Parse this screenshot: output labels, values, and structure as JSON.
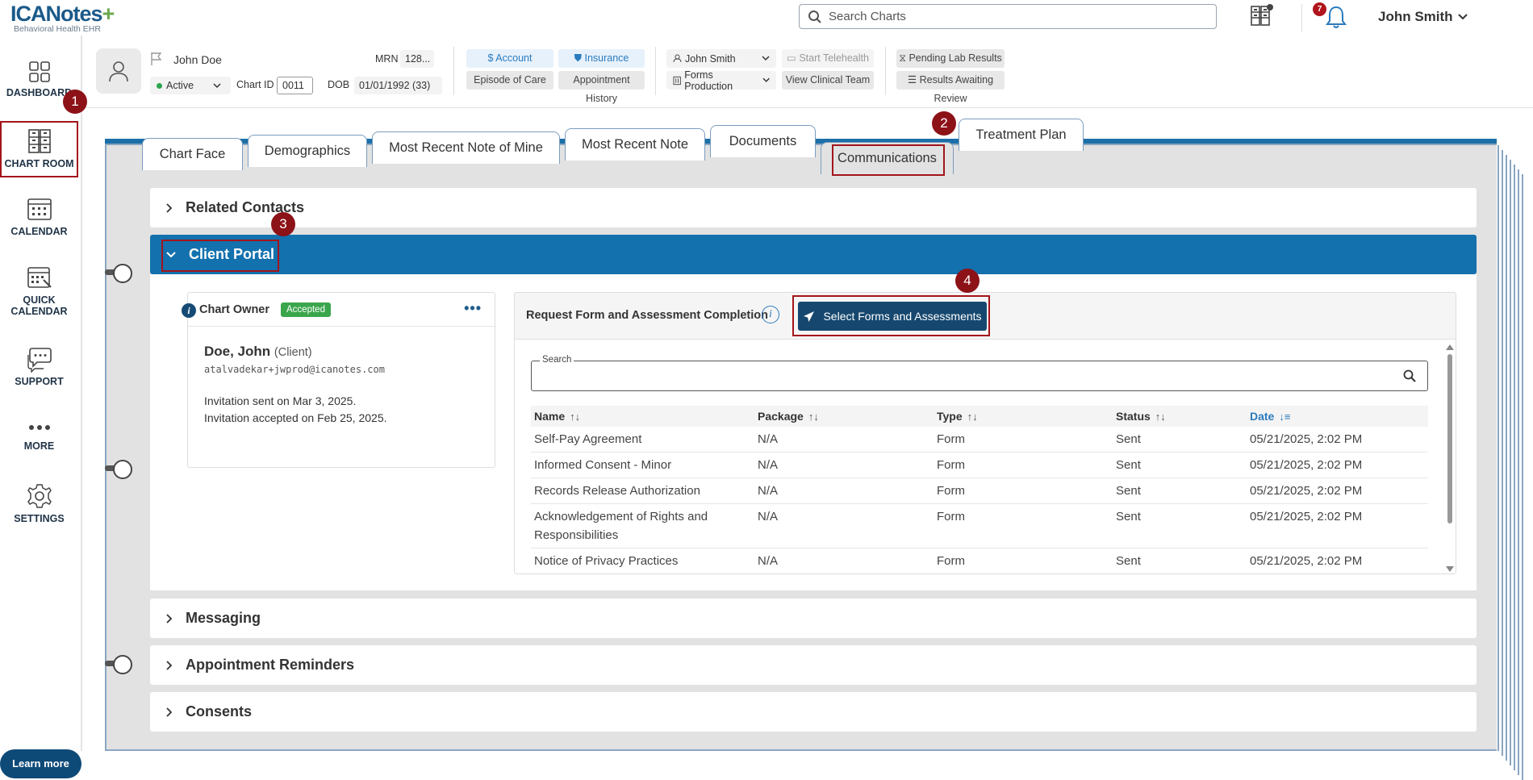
{
  "app": {
    "logo_main": "ICANotes",
    "logo_plus": "+",
    "logo_sub": "Behavioral Health EHR",
    "search_placeholder": "Search Charts",
    "notification_count": "7",
    "user_name": "John Smith"
  },
  "nav": {
    "items": [
      {
        "label": "DASHBOARD",
        "icon": "dashboard-icon"
      },
      {
        "label": "CHART ROOM",
        "icon": "chart-room-icon"
      },
      {
        "label": "CALENDAR",
        "icon": "calendar-icon"
      },
      {
        "label": "QUICK",
        "label2": "CALENDAR",
        "icon": "quick-calendar-icon"
      },
      {
        "label": "SUPPORT",
        "icon": "support-icon"
      },
      {
        "label": "MORE",
        "icon": "more-icon"
      },
      {
        "label": "SETTINGS",
        "icon": "gear-icon"
      }
    ],
    "learn_more": "Learn more"
  },
  "steps": [
    "1",
    "2",
    "3",
    "4"
  ],
  "patient": {
    "name": "John Doe",
    "status": "Active",
    "chart_id_label": "Chart ID",
    "chart_id": "0011",
    "mrn_label": "MRN",
    "mrn": "128...",
    "dob_label": "DOB",
    "dob": "01/01/1992 (33)"
  },
  "header_buttons": {
    "account": "Account",
    "insurance": "Insurance",
    "episode": "Episode of Care",
    "appointment_history": "Appointment History",
    "provider": "John Smith",
    "forms_production": "Forms Production",
    "start_telehealth": "Start Telehealth",
    "view_clinical_team": "View Clinical Team",
    "pending_lab": "Pending Lab Results",
    "results_awaiting": "Results Awaiting Review"
  },
  "tabs": [
    "Chart Face",
    "Demographics",
    "Most Recent Note of Mine",
    "Most Recent Note",
    "Documents",
    "Communications",
    "Treatment Plan"
  ],
  "sections": {
    "related_contacts": "Related Contacts",
    "client_portal": "Client Portal",
    "messaging": "Messaging",
    "appointment_reminders": "Appointment Reminders",
    "consents": "Consents"
  },
  "owner": {
    "title": "Chart Owner",
    "badge": "Accepted",
    "name": "Doe, John",
    "role": "(Client)",
    "email": "atalvadekar+jwprod@icanotes.com",
    "invite_sent": "Invitation sent on Mar 3, 2025.",
    "invite_accepted": "Invitation accepted on Feb 25, 2025."
  },
  "request": {
    "title": "Request Form and Assessment Completion",
    "button": "Select Forms and Assessments",
    "search_label": "Search",
    "columns": [
      "Name",
      "Package",
      "Type",
      "Status",
      "Date"
    ],
    "rows": [
      [
        "Self-Pay Agreement",
        "N/A",
        "Form",
        "Sent",
        "05/21/2025, 2:02 PM"
      ],
      [
        "Informed Consent - Minor",
        "N/A",
        "Form",
        "Sent",
        "05/21/2025, 2:02 PM"
      ],
      [
        "Records Release Authorization",
        "N/A",
        "Form",
        "Sent",
        "05/21/2025, 2:02 PM"
      ],
      [
        "Acknowledgement of Rights and Responsibilities",
        "N/A",
        "Form",
        "Sent",
        "05/21/2025, 2:02 PM"
      ],
      [
        "Notice of Privacy Practices",
        "N/A",
        "Form",
        "Sent",
        "05/21/2025, 2:02 PM"
      ]
    ]
  },
  "colors": {
    "accent_blue": "#1371ae",
    "dark_blue": "#16486f",
    "step_red": "#8c1218",
    "accepted_green": "#3aa64c"
  }
}
